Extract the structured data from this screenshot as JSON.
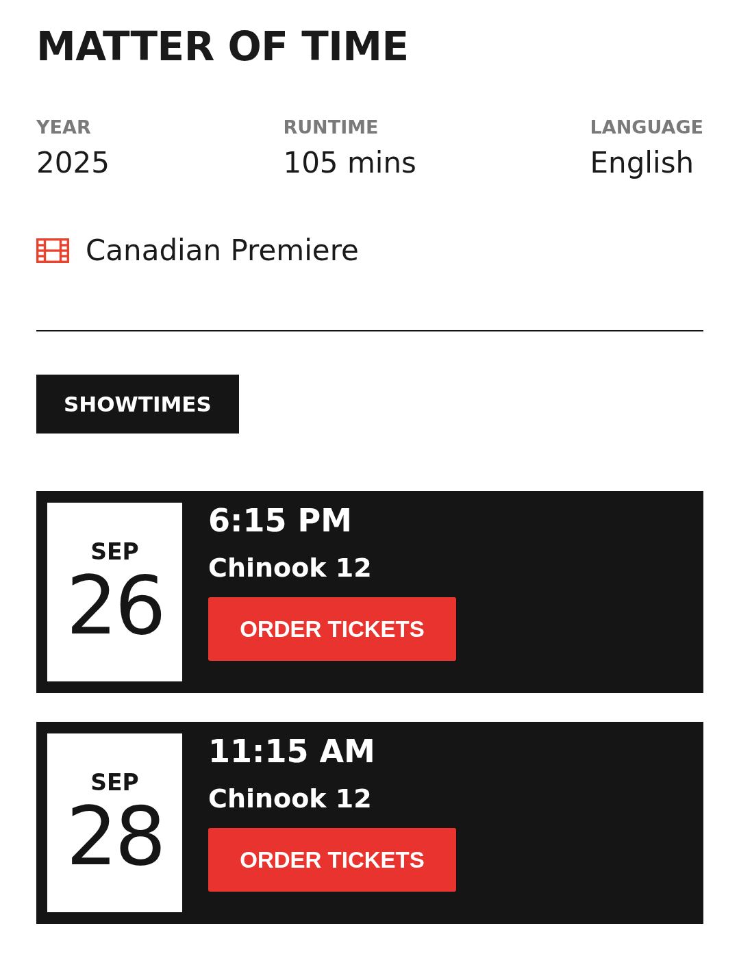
{
  "title": "MATTER OF TIME",
  "details": [
    {
      "label": "YEAR",
      "value": "2025"
    },
    {
      "label": "RUNTIME",
      "value": "105 mins"
    },
    {
      "label": "LANGUAGE",
      "value": "English"
    }
  ],
  "premiere": {
    "label": "Canadian Premiere"
  },
  "showtimes_tab": {
    "label": "SHOWTIMES"
  },
  "showtimes": [
    {
      "month": "SEP",
      "day": "26",
      "time": "6:15 PM",
      "venue": "Chinook 12",
      "button": "ORDER TICKETS"
    },
    {
      "month": "SEP",
      "day": "28",
      "time": "11:15 AM",
      "venue": "Chinook 12",
      "button": "ORDER TICKETS"
    }
  ]
}
